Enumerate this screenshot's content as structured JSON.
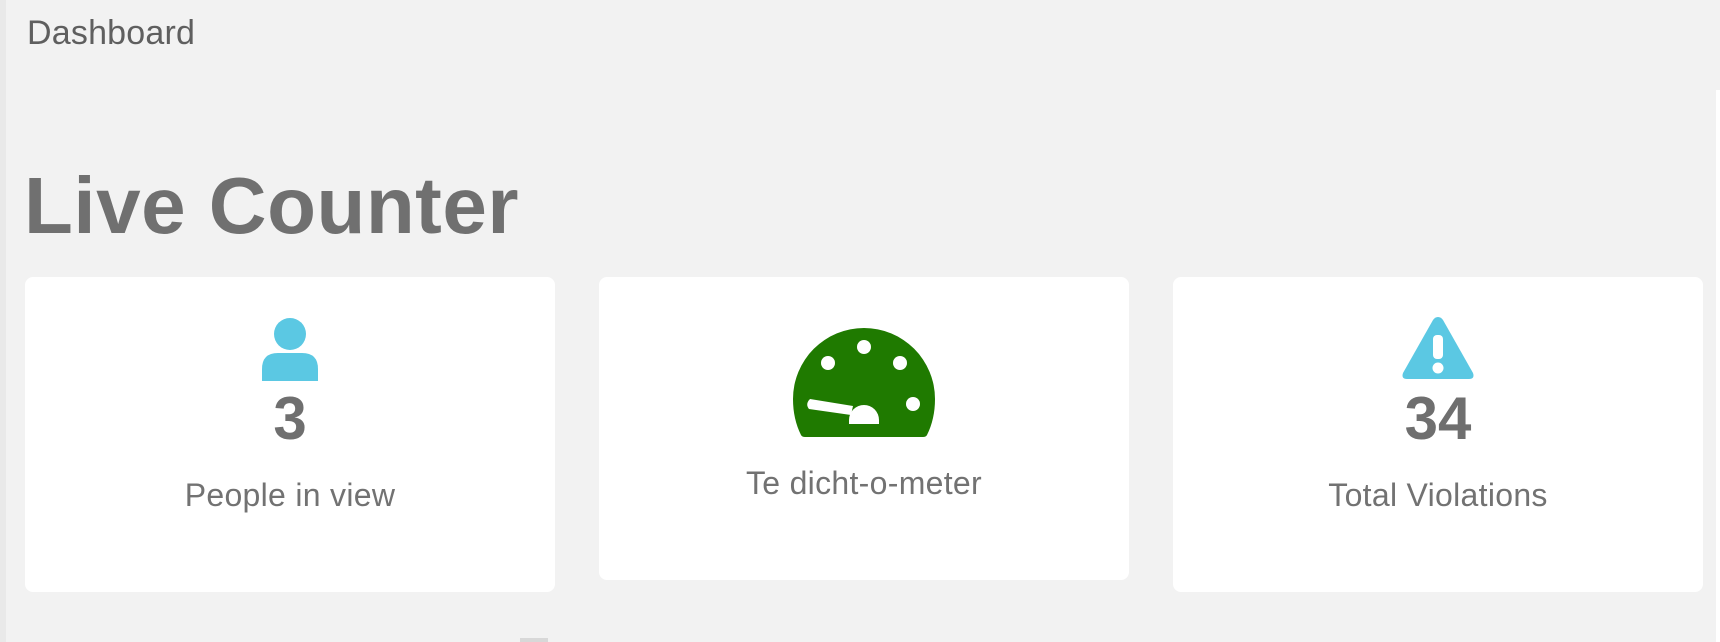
{
  "breadcrumb": {
    "label": "Dashboard"
  },
  "page": {
    "title": "Live Counter"
  },
  "colors": {
    "accent_blue": "#5bc8e3",
    "meter_green": "#1f7a00",
    "background": "#f2f2f2",
    "card": "#ffffff",
    "text": "#6e6e6e"
  },
  "cards": [
    {
      "icon": "person-icon",
      "value": "3",
      "label": "People in view"
    },
    {
      "icon": "gauge-icon",
      "label": "Te dicht-o-meter"
    },
    {
      "icon": "warning-icon",
      "value": "34",
      "label": "Total Violations"
    }
  ]
}
